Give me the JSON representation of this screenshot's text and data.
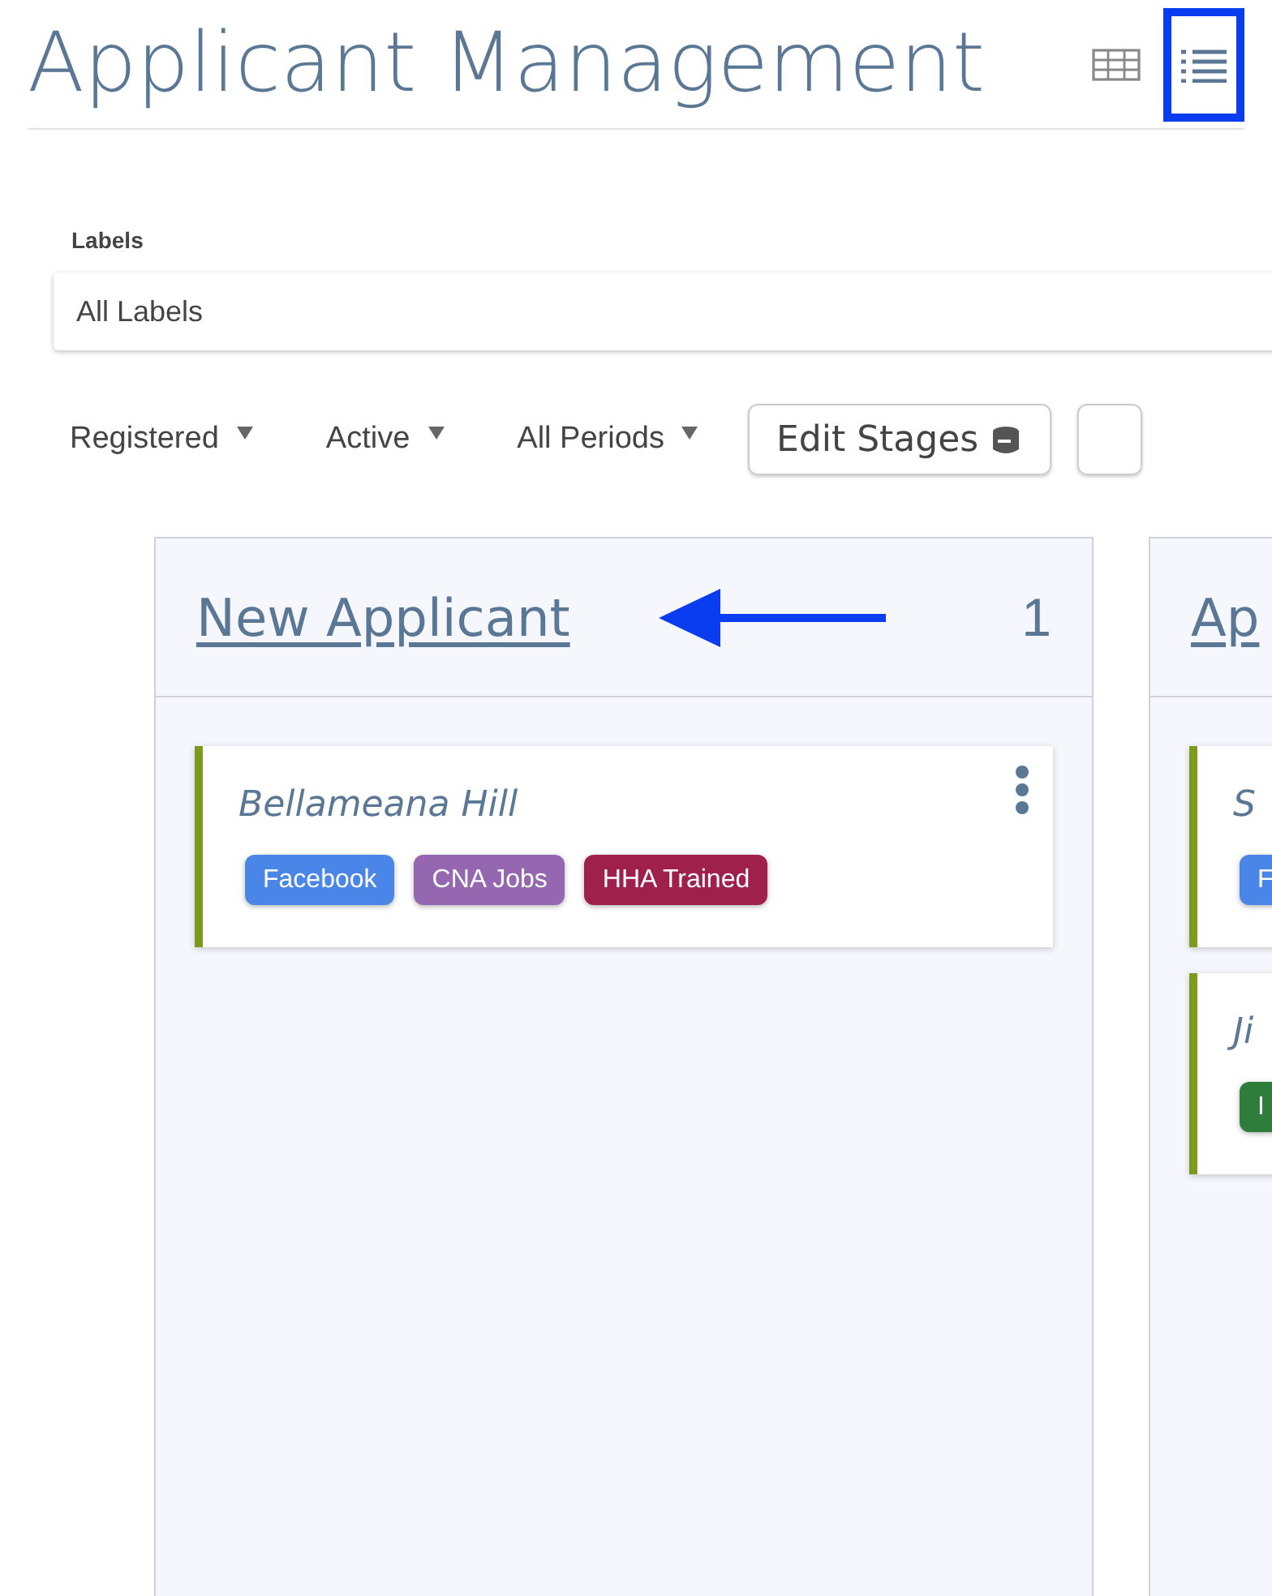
{
  "title": "Applicant Management",
  "view_toggle": [
    {
      "kind": "grid",
      "selected": false
    },
    {
      "kind": "list",
      "selected": true
    }
  ],
  "labels_filter": {
    "label": "Labels",
    "value": "All Labels"
  },
  "filters": [
    {
      "label": "Registered"
    },
    {
      "label": "Active"
    },
    {
      "label": "All Periods"
    }
  ],
  "edit_stages_button": {
    "label": "Edit Stages"
  },
  "stages": [
    {
      "name": "New Applicant",
      "count": "1",
      "cards": [
        {
          "name": "Bellameana Hill",
          "menu": true,
          "tags": [
            {
              "label": "Facebook",
              "color": "#4a86e8"
            },
            {
              "label": "CNA Jobs",
              "color": "#9467b0"
            },
            {
              "label": "HHA Trained",
              "color": "#a0204c"
            }
          ]
        }
      ]
    },
    {
      "name": "Ap",
      "cards": [
        {
          "name": "S",
          "tags": [
            {
              "label": "F",
              "color": "#4a86e8"
            }
          ]
        },
        {
          "name": "Ji",
          "tags": [
            {
              "label": "I",
              "color": "#2e7d3a"
            }
          ]
        }
      ]
    }
  ]
}
